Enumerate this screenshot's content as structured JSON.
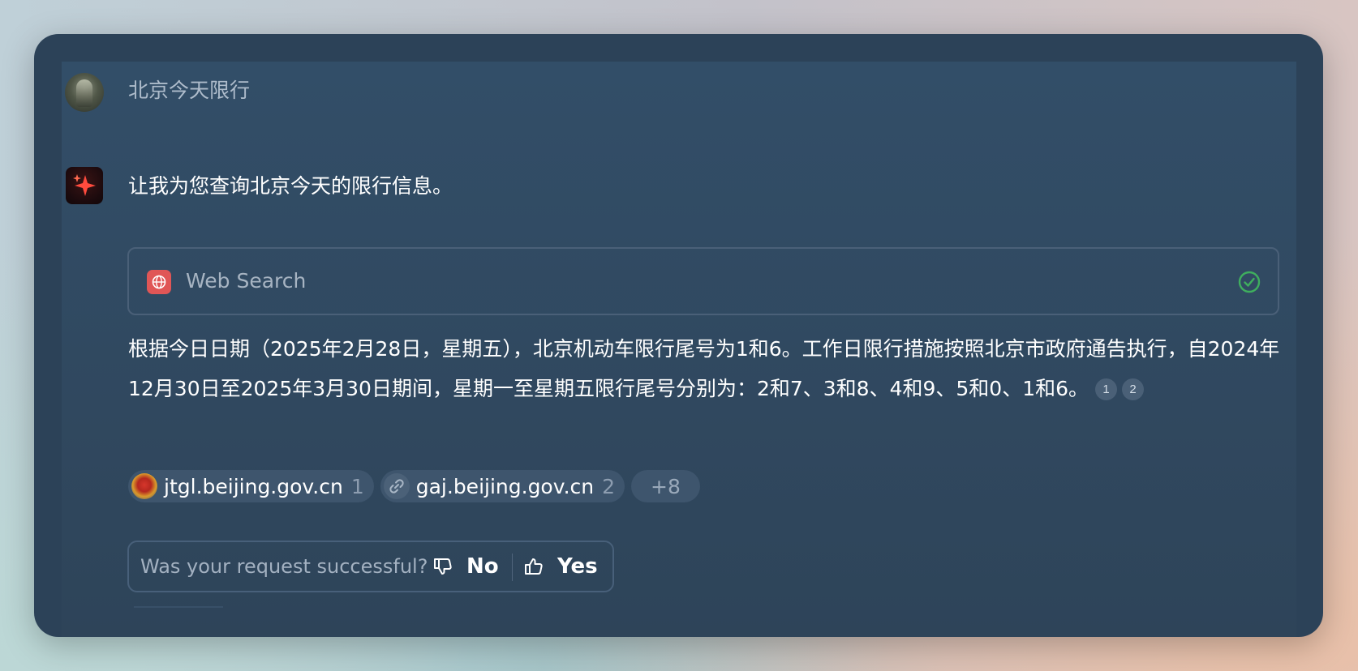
{
  "conversation": {
    "user_message": "北京今天限行",
    "assistant_intro": "让我为您查询北京今天的限行信息。",
    "tool": {
      "name": "Web Search",
      "icon": "globe-icon",
      "status_icon": "check-circle-icon",
      "status_color": "#3fae5e"
    },
    "answer_text": "根据今日日期（2025年2月28日，星期五），北京机动车限行尾号为1和6。工作日限行措施按照北京市政府通告执行，自2024年12月30日至2025年3月30日期间，星期一至星期五限行尾号分别为：2和7、3和8、4和9、5和0、1和6。",
    "citations": [
      "1",
      "2"
    ],
    "sources": [
      {
        "domain": "jtgl.beijing.gov.cn",
        "count": "1",
        "icon": "police-emblem-icon"
      },
      {
        "domain": "gaj.beijing.gov.cn",
        "count": "2",
        "icon": "link-icon"
      }
    ],
    "more_sources": "+8"
  },
  "feedback": {
    "question": "Was your request successful?",
    "no_label": "No",
    "yes_label": "Yes"
  },
  "colors": {
    "window_bg": "#2c4258",
    "panel_bg": "#324e68",
    "tool_icon_bg": "#e05656",
    "chip_bg": "#3e556d"
  }
}
